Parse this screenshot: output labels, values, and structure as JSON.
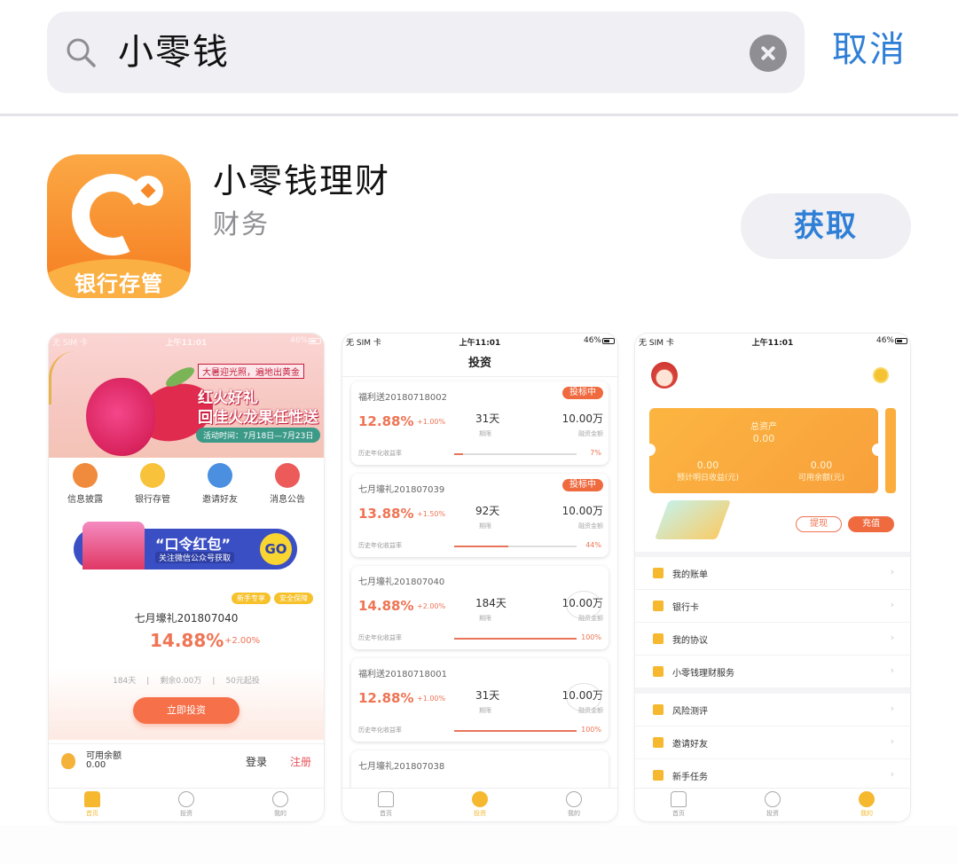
{
  "search": {
    "query": "小零钱",
    "cancel_label": "取消"
  },
  "app": {
    "name": "小零钱理财",
    "category": "财务",
    "icon_badge": "银行存管",
    "get_label": "获取",
    "brand_color": "#f7892b"
  },
  "status_bar": {
    "carrier": "无 SIM 卡",
    "time": "上午11:01",
    "battery": "46%"
  },
  "shot1": {
    "banner": {
      "subtitle": "大暑迎光照，遍地出黄金",
      "title_line1": "红火好礼",
      "title_line2": "回佳火龙果任性送",
      "date": "活动时间：7月18日—7月23日"
    },
    "quick_actions": [
      {
        "label": "信息披露",
        "icon": "megaphone-icon",
        "color": "#f08a3c"
      },
      {
        "label": "银行存管",
        "icon": "shield-icon",
        "color": "#f8c23a"
      },
      {
        "label": "邀请好友",
        "icon": "share-icon",
        "color": "#4a8fe0"
      },
      {
        "label": "消息公告",
        "icon": "notice-icon",
        "color": "#ec5a5a"
      }
    ],
    "promo": {
      "title": "“口令红包”",
      "subtitle": "关注微信公众号获取",
      "go_label": "GO"
    },
    "product": {
      "tags": [
        "新手专享",
        "安全保障"
      ],
      "name": "七月壕礼201807040",
      "rate": "14.88%",
      "bonus": "+2.00%",
      "term": "184天",
      "remaining": "剩余0.00万",
      "min_invest": "50元起投",
      "invest_label": "立即投资"
    },
    "balance": {
      "label": "可用余额",
      "value": "0.00",
      "login_label": "登录",
      "register_label": "注册"
    }
  },
  "shot2": {
    "title": "投资",
    "rate_label": "历史年化收益率",
    "term_label": "期限",
    "amount_label": "融资金额",
    "loans": [
      {
        "name": "福利送20180718002",
        "status": "投标中",
        "rate": "12.88%",
        "bonus": "+1.00%",
        "term": "31天",
        "amount": "10.00万",
        "progress_pct": 7,
        "progress_label": "7%"
      },
      {
        "name": "七月壕礼201807039",
        "status": "投标中",
        "rate": "13.88%",
        "bonus": "+1.50%",
        "term": "92天",
        "amount": "10.00万",
        "progress_pct": 44,
        "progress_label": "44%"
      },
      {
        "name": "七月壕礼201807040",
        "status": "",
        "rate": "14.88%",
        "bonus": "+2.00%",
        "term": "184天",
        "amount": "10.00万",
        "progress_pct": 100,
        "progress_label": "100%"
      },
      {
        "name": "福利送20180718001",
        "status": "",
        "rate": "12.88%",
        "bonus": "+1.00%",
        "term": "31天",
        "amount": "10.00万",
        "progress_pct": 100,
        "progress_label": "100%"
      },
      {
        "name": "七月壕礼201807038",
        "status": "",
        "rate": "",
        "bonus": "",
        "term": "",
        "amount": "",
        "progress_pct": null,
        "progress_label": ""
      }
    ]
  },
  "shot3": {
    "total_assets_label": "总资产",
    "total_assets": "0.00",
    "expected_income_value": "0.00",
    "expected_income_label": "预计明日收益(元)",
    "available_value": "0.00",
    "available_label": "可用余额(元)",
    "withdraw_label": "提现",
    "recharge_label": "充值",
    "menu_group1": [
      {
        "label": "我的账单",
        "icon": "bill-icon"
      },
      {
        "label": "银行卡",
        "icon": "bank-card-icon"
      },
      {
        "label": "我的协议",
        "icon": "agreement-icon"
      },
      {
        "label": "小零钱理财服务",
        "icon": "service-icon"
      }
    ],
    "menu_group2": [
      {
        "label": "风险测评",
        "icon": "risk-assessment-icon"
      },
      {
        "label": "邀请好友",
        "icon": "invite-icon"
      },
      {
        "label": "新手任务",
        "icon": "task-icon"
      }
    ],
    "chevron": "›"
  },
  "tabbar": {
    "tabs": [
      "首页",
      "投资",
      "我的"
    ],
    "active_color": "#f5b82e"
  }
}
